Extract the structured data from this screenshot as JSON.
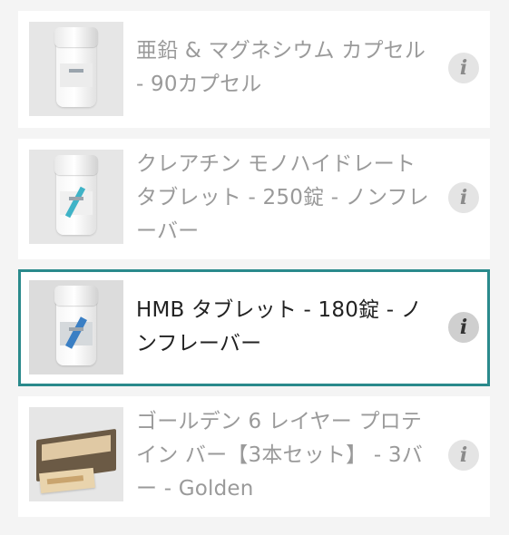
{
  "products": [
    {
      "title": "亜鉛 & マグネシウム カプセル - 90カプセル",
      "image_icon": "capsule-bottle-icon",
      "info_glyph": "i",
      "selected": false
    },
    {
      "title": "クレアチン モノハイドレート タブレット - 250錠 - ノンフレーバー",
      "image_icon": "tablet-bottle-icon",
      "info_glyph": "i",
      "selected": false
    },
    {
      "title": "HMB タブレット - 180錠 - ノンフレーバー",
      "image_icon": "tablet-bottle-icon",
      "info_glyph": "i",
      "selected": true
    },
    {
      "title": "ゴールデン 6 レイヤー プロテイン バー【3本セット】 - 3バー - Golden",
      "image_icon": "protein-bar-box-icon",
      "info_glyph": "i",
      "selected": false
    }
  ],
  "colors": {
    "background": "#f4f4f4",
    "card": "#ffffff",
    "selected_border": "#2a8a8c",
    "muted_text": "#9a9a9a",
    "active_text": "#222222"
  }
}
